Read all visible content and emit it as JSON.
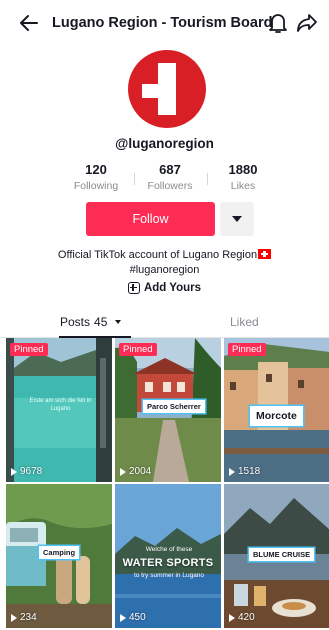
{
  "header": {
    "title": "Lugano Region - Tourism Board",
    "back_icon": "arrow-left-icon",
    "bell_icon": "bell-icon",
    "share_icon": "share-arrow-icon"
  },
  "profile": {
    "avatar_icon": "red-white-cross-logo",
    "username": "@luganoregion",
    "stats": {
      "following": {
        "value": "120",
        "label": "Following"
      },
      "followers": {
        "value": "687",
        "label": "Followers"
      },
      "likes": {
        "value": "1880",
        "label": "Likes"
      }
    },
    "follow_label": "Follow",
    "bio_line1": "Official TikTok account of Lugano Region",
    "bio_line2": "#luganoregion",
    "add_yours": "Add Yours"
  },
  "tabs": {
    "posts_label": "Posts",
    "posts_count": "45",
    "liked_label": "Liked"
  },
  "videos": [
    {
      "pinned": "Pinned",
      "views": "9678",
      "caption": "Erste am sich die feit in Lugano"
    },
    {
      "pinned": "Pinned",
      "views": "2004",
      "caption": "Parco Scherrer"
    },
    {
      "pinned": "Pinned",
      "views": "1518",
      "caption": "Morcote"
    },
    {
      "views": "234",
      "caption": "Camping"
    },
    {
      "views": "450",
      "caption_top": "Welche of these",
      "caption": "WATER SPORTS",
      "caption_bottom": "to try summer in Lugano"
    },
    {
      "views": "420",
      "caption": "BLUME CRUISE"
    }
  ],
  "colors": {
    "accent": "#fe2c55",
    "text": "#161823",
    "muted": "#8a8b91",
    "caption_border": "#4fc3f7"
  }
}
